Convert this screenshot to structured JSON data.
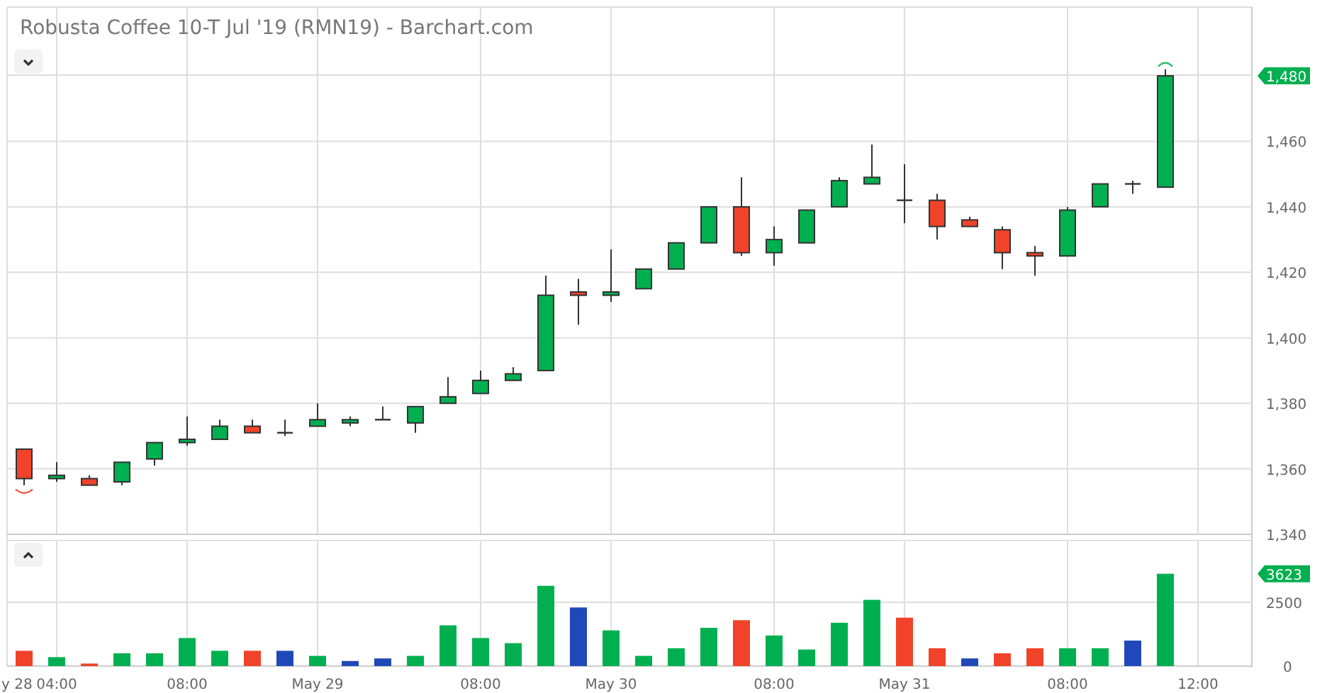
{
  "title": "Robusta Coffee 10-T Jul '19 (RMN19) - Barchart.com",
  "price_pane": {
    "collapse_toggle": {
      "expanded": true
    },
    "last_tag": "1,480",
    "chart_data": {
      "type": "candlestick",
      "grid": true,
      "ohlc": [
        [
          1366,
          1366,
          1355,
          1357
        ],
        [
          1357,
          1362,
          1356,
          1358
        ],
        [
          1357,
          1358,
          1355,
          1355
        ],
        [
          1356,
          1362,
          1355,
          1362
        ],
        [
          1363,
          1368,
          1361,
          1368
        ],
        [
          1368,
          1376,
          1367,
          1369
        ],
        [
          1369,
          1375,
          1369,
          1373
        ],
        [
          1373,
          1375,
          1371,
          1371
        ],
        [
          1371,
          1375,
          1370,
          1371
        ],
        [
          1373,
          1380,
          1373,
          1375
        ],
        [
          1374,
          1376,
          1373,
          1375
        ],
        [
          1375,
          1379,
          1375,
          1375
        ],
        [
          1374,
          1379,
          1371,
          1379
        ],
        [
          1380,
          1388,
          1380,
          1382
        ],
        [
          1383,
          1390,
          1383,
          1387
        ],
        [
          1387,
          1391,
          1387,
          1389
        ],
        [
          1390,
          1419,
          1390,
          1413
        ],
        [
          1414,
          1418,
          1404,
          1413
        ],
        [
          1413,
          1427,
          1411,
          1414
        ],
        [
          1415,
          1421,
          1415,
          1421
        ],
        [
          1421,
          1429,
          1421,
          1429
        ],
        [
          1429,
          1440,
          1429,
          1440
        ],
        [
          1440,
          1449,
          1425,
          1426
        ],
        [
          1426,
          1434,
          1422,
          1430
        ],
        [
          1429,
          1439,
          1429,
          1439
        ],
        [
          1440,
          1449,
          1440,
          1448
        ],
        [
          1447,
          1459,
          1447,
          1449
        ],
        [
          1442,
          1453,
          1435,
          1442
        ],
        [
          1442,
          1444,
          1430,
          1434
        ],
        [
          1436,
          1437,
          1434,
          1434
        ],
        [
          1433,
          1434,
          1421,
          1426
        ],
        [
          1426,
          1428,
          1419,
          1425
        ],
        [
          1425,
          1440,
          1425,
          1439
        ],
        [
          1440,
          1447,
          1440,
          1447
        ],
        [
          1447,
          1448,
          1444,
          1447
        ],
        [
          1446,
          1482,
          1446,
          1480
        ]
      ],
      "ylim": [
        1340,
        1501
      ],
      "yticks": [
        {
          "value": 1340,
          "label": "1,340"
        },
        {
          "value": 1360,
          "label": "1,360"
        },
        {
          "value": 1380,
          "label": "1,380"
        },
        {
          "value": 1400,
          "label": "1,400"
        },
        {
          "value": 1420,
          "label": "1,420"
        },
        {
          "value": 1440,
          "label": "1,440"
        },
        {
          "value": 1460,
          "label": "1,460"
        }
      ]
    }
  },
  "volume_pane": {
    "collapse_toggle": {
      "expanded": false
    },
    "last_tag": "3623",
    "chart_data": {
      "type": "bar",
      "grid": true,
      "categories": [
        null,
        "04:00",
        null,
        null,
        null,
        "08:00",
        null,
        null,
        null,
        "May 29",
        null,
        null,
        null,
        null,
        "08:00",
        null,
        null,
        null,
        "May 30",
        null,
        null,
        null,
        null,
        "08:00",
        null,
        null,
        null,
        "May 31",
        null,
        null,
        null,
        null,
        "08:00",
        null,
        null,
        null,
        "12:00"
      ],
      "series": [
        {
          "color": "#00b050",
          "values": [
            null,
            350,
            null,
            500,
            500,
            1100,
            600,
            null,
            null,
            400,
            null,
            null,
            400,
            1600,
            1100,
            900,
            3150,
            null,
            1400,
            400,
            700,
            1500,
            null,
            1200,
            650,
            1700,
            2600,
            null,
            null,
            null,
            null,
            null,
            700,
            700,
            null,
            3623,
            null
          ]
        },
        {
          "color": "#f0432a",
          "values": [
            600,
            null,
            100,
            null,
            null,
            null,
            null,
            600,
            null,
            null,
            null,
            null,
            null,
            null,
            null,
            null,
            null,
            null,
            null,
            null,
            null,
            null,
            1800,
            null,
            null,
            null,
            null,
            1900,
            700,
            null,
            500,
            700,
            null,
            null,
            null,
            null,
            null
          ]
        },
        {
          "color": "#2048b8",
          "values": [
            null,
            null,
            null,
            null,
            null,
            null,
            null,
            null,
            600,
            null,
            200,
            300,
            null,
            null,
            null,
            null,
            null,
            2300,
            null,
            null,
            null,
            null,
            null,
            null,
            null,
            null,
            null,
            null,
            null,
            300,
            null,
            null,
            null,
            null,
            1000,
            null,
            null
          ]
        }
      ],
      "ylim": [
        0,
        4950
      ],
      "yticks": [
        0,
        {
          "value": 2500,
          "label": "2500"
        }
      ]
    },
    "edge_label": "y 28"
  }
}
